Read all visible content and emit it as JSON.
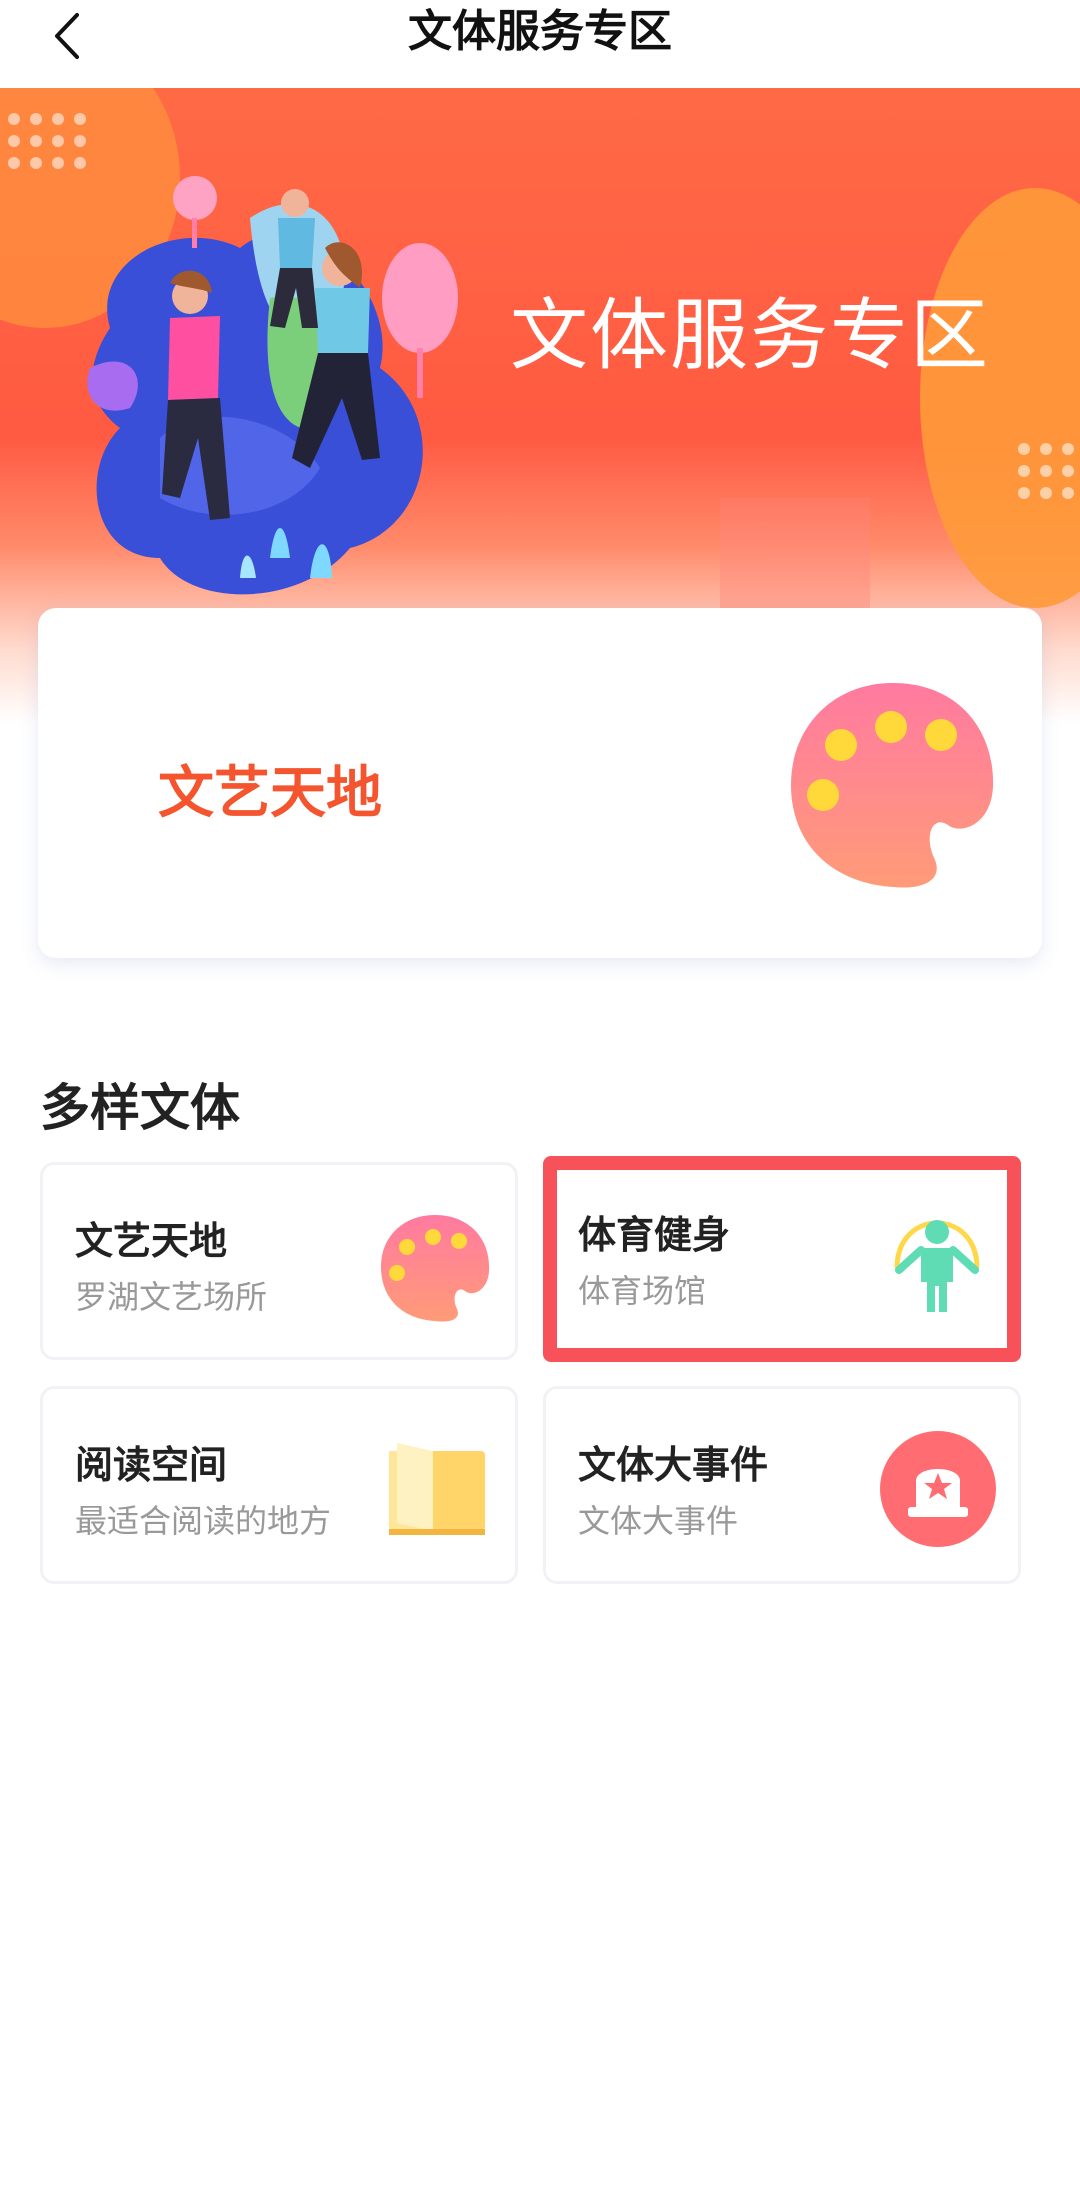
{
  "header": {
    "title": "文体服务专区",
    "back_icon": "chevron-left-icon"
  },
  "banner": {
    "title": "文体服务专区",
    "illustration": "running-people-illustration"
  },
  "feature": {
    "label": "文艺天地",
    "icon": "palette-icon",
    "label_color": "#f4552f"
  },
  "section": {
    "title": "多样文体",
    "tiles": [
      {
        "title": "文艺天地",
        "subtitle": "罗湖文艺场所",
        "icon": "palette-icon"
      },
      {
        "title": "体育健身",
        "subtitle": "体育场馆",
        "icon": "jump-rope-icon",
        "highlighted": true
      },
      {
        "title": "阅读空间",
        "subtitle": "最适合阅读的地方",
        "icon": "book-icon"
      },
      {
        "title": "文体大事件",
        "subtitle": "文体大事件",
        "icon": "event-star-icon"
      }
    ]
  },
  "colors": {
    "accent": "#f4552f",
    "highlight_border": "#f7525a",
    "banner": "#ff5a42"
  }
}
